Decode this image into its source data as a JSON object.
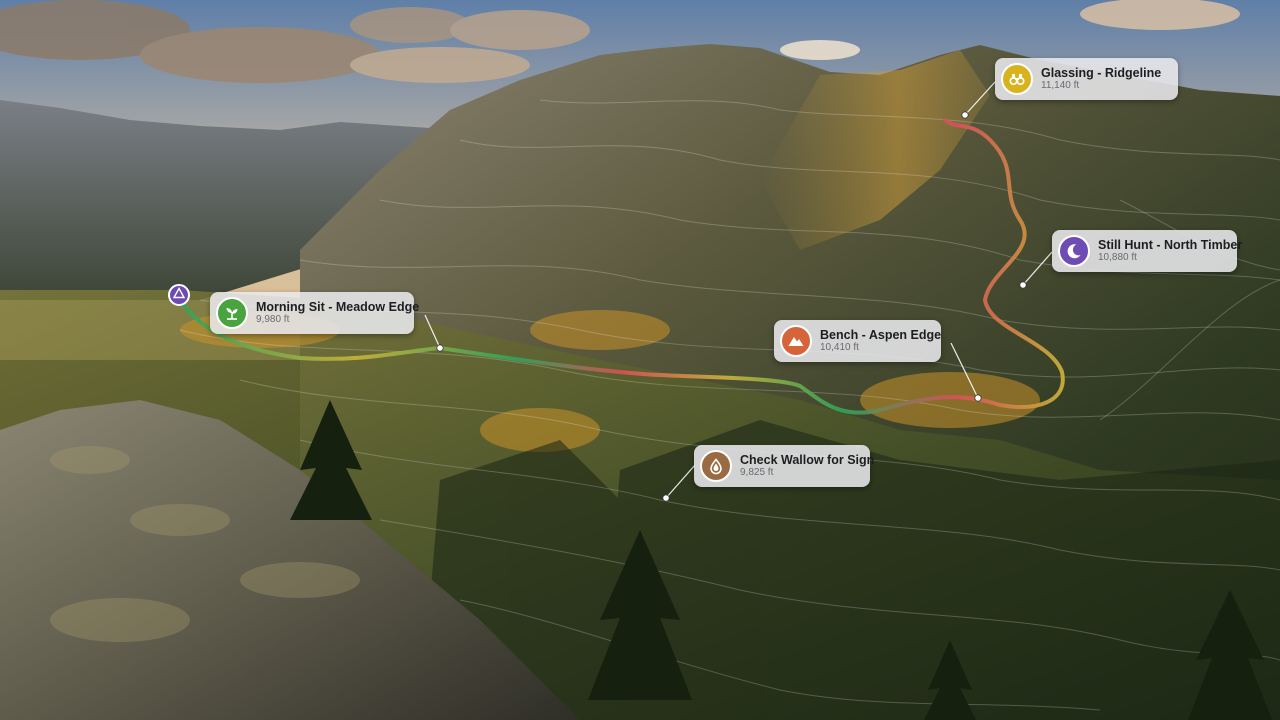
{
  "colors": {
    "route_green": "#2fa35a",
    "route_yellow": "#c9b23a",
    "route_red": "#d8505a",
    "label_bg": "#e8e8ec",
    "start_marker": "#6d4bb0"
  },
  "start": {
    "icon": "triangle-outline-icon"
  },
  "waypoints": [
    {
      "name": "Glassing - Ridgeline",
      "elevation": "11,140 ft",
      "icon": "binoculars-icon",
      "icon_color": "#d8b31e"
    },
    {
      "name": "Still Hunt - North Timber",
      "elevation": "10,880 ft",
      "icon": "crescent-moon-icon",
      "icon_color": "#6f4bb4"
    },
    {
      "name": "Morning Sit - Meadow Edge",
      "elevation": "9,980 ft",
      "icon": "plant-sprout-icon",
      "icon_color": "#49a33e"
    },
    {
      "name": "Bench - Aspen Edge",
      "elevation": "10,410 ft",
      "icon": "mountain-icon",
      "icon_color": "#d6643a"
    },
    {
      "name": "Check Wallow for Sign",
      "elevation": "9,825 ft",
      "icon": "water-drop-icon",
      "icon_color": "#9a6a42"
    }
  ]
}
